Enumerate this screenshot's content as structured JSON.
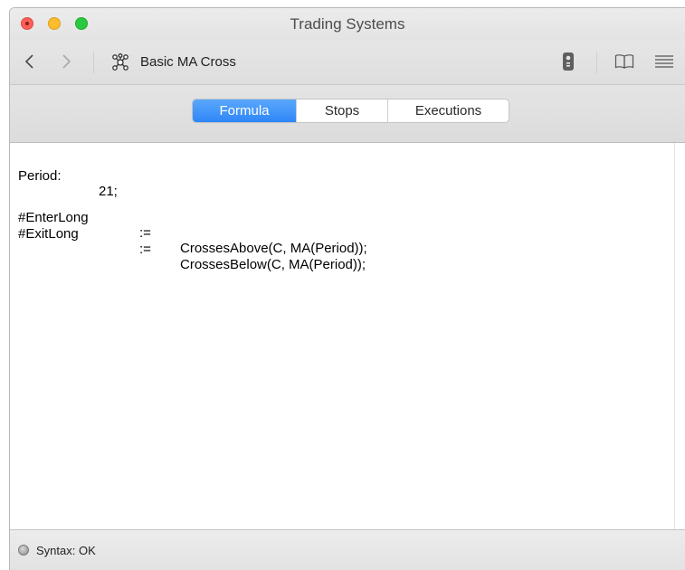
{
  "window": {
    "title": "Trading Systems"
  },
  "toolbar": {
    "document_title": "Basic MA Cross",
    "icons": {
      "back": "chevron-left-icon",
      "forward": "chevron-right-icon",
      "document": "network-nodes-icon",
      "remote": "remote-icon",
      "book": "book-icon",
      "menu": "list-icon"
    }
  },
  "tabs": [
    {
      "label": "Formula",
      "active": true
    },
    {
      "label": "Stops",
      "active": false
    },
    {
      "label": "Executions",
      "active": false
    }
  ],
  "editor": {
    "lines": [
      {
        "name": "Period:",
        "op": "",
        "value": "21;"
      },
      {
        "name": "#EnterLong",
        "op": ":=",
        "value": "CrossesAbove(C, MA(Period));"
      },
      {
        "name": "#ExitLong",
        "op": ":=",
        "value": "CrossesBelow(C, MA(Period));"
      }
    ]
  },
  "status": {
    "text": "Syntax: OK"
  },
  "colors": {
    "active_tab": "#3b8ef8",
    "close": "#fc5f57",
    "minimize": "#fdbc2e",
    "maximize": "#29c840"
  }
}
